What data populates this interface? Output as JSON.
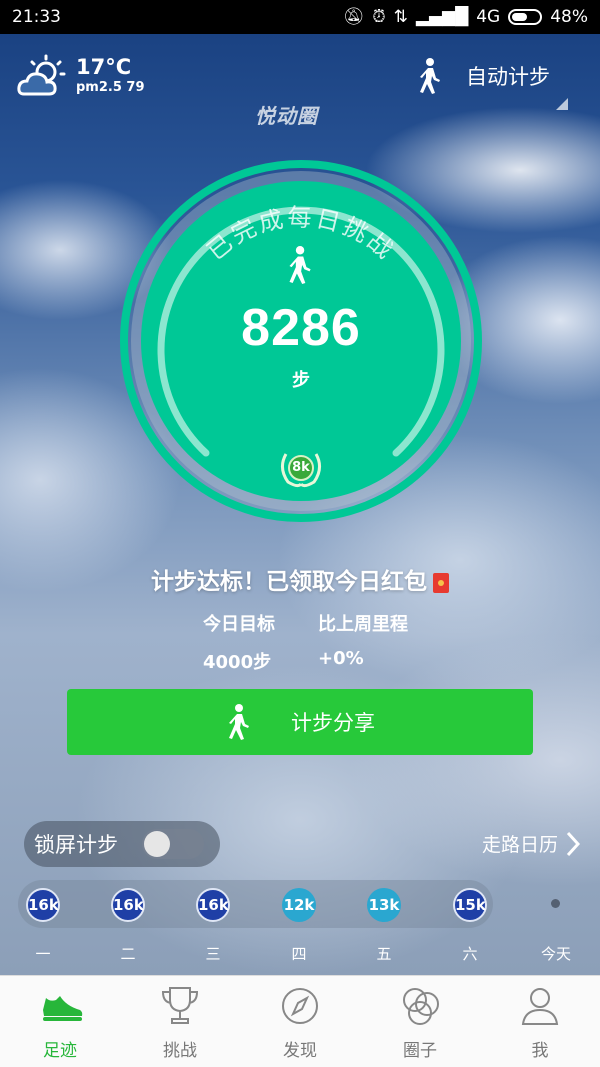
{
  "status_bar": {
    "time": "21:33",
    "network": "4G",
    "battery": "48%",
    "battery_level": 0.48
  },
  "header": {
    "temperature": "17°C",
    "air_quality": "pm2.5 79",
    "mode_label": "自动计步",
    "logo_text": "悦动圈"
  },
  "ring": {
    "challenge_text": "已完成每日挑战",
    "steps": "8286",
    "unit": "步",
    "badge": "8k",
    "accent_color": "#00c896"
  },
  "goal": {
    "message": "计步达标！已领取今日红包",
    "target_label": "今日目标",
    "target_value": "4000步",
    "compare_label": "比上周里程",
    "compare_value": "+0%"
  },
  "share_button": {
    "label": "计步分享"
  },
  "lock_screen": {
    "label": "锁屏计步",
    "enabled": false
  },
  "calendar_link": {
    "label": "走路日历"
  },
  "week": [
    {
      "day": "一",
      "value": "16k",
      "style": "dark"
    },
    {
      "day": "二",
      "value": "16k",
      "style": "dark"
    },
    {
      "day": "三",
      "value": "16k",
      "style": "dark"
    },
    {
      "day": "四",
      "value": "12k",
      "style": "light"
    },
    {
      "day": "五",
      "value": "13k",
      "style": "light"
    },
    {
      "day": "六",
      "value": "15k",
      "style": "dark"
    },
    {
      "day": "今天",
      "value": "",
      "style": "dot"
    }
  ],
  "nav": [
    {
      "label": "足迹",
      "icon": "shoe-icon",
      "active": true
    },
    {
      "label": "挑战",
      "icon": "trophy-icon",
      "active": false
    },
    {
      "label": "发现",
      "icon": "compass-icon",
      "active": false
    },
    {
      "label": "圈子",
      "icon": "circles-icon",
      "active": false
    },
    {
      "label": "我",
      "icon": "person-icon",
      "active": false
    }
  ]
}
